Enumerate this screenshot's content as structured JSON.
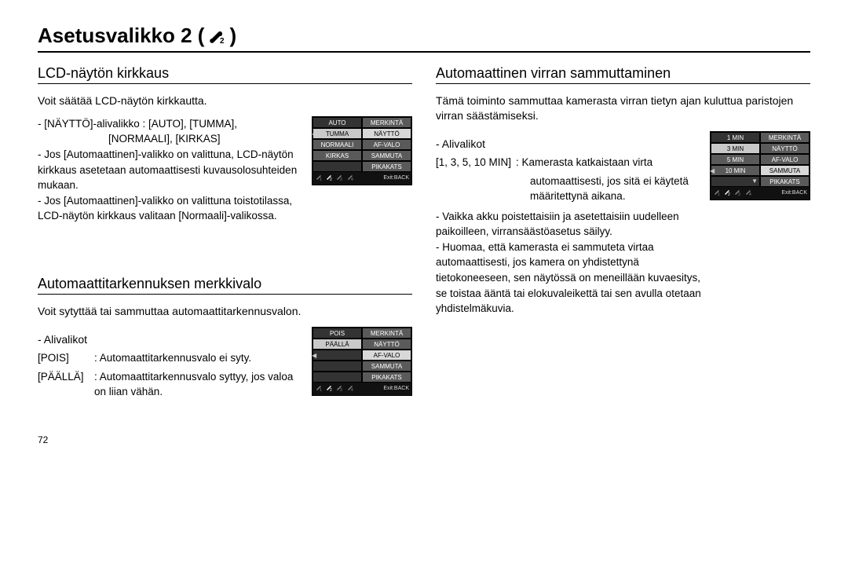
{
  "page_number": "72",
  "title": "Asetusvalikko 2 (",
  "title_close": ")",
  "left": {
    "section1": {
      "heading": "LCD-näytön kirkkaus",
      "intro": "Voit säätää LCD-näytön kirkkautta.",
      "b1a": "- [NÄYTTÖ]-alivalikko : [AUTO], [TUMMA],",
      "b1b": "[NORMAALI], [KIRKAS]",
      "b2": "- Jos [Automaattinen]-valikko on valittuna, LCD-näytön kirkkaus asetetaan automaattisesti kuvausolosuhteiden mukaan.",
      "b3": "- Jos [Automaattinen]-valikko on valittuna toistotilassa, LCD-näytön kirkkaus valitaan [Normaali]-valikossa."
    },
    "menu1": {
      "leftcol": [
        "AUTO",
        "TUMMA",
        "NORMAALI",
        "KIRKAS",
        ""
      ],
      "rightcol": [
        "MERKINTÄ",
        "NÄYTTÖ",
        "AF-VALO",
        "SAMMUTA",
        "PIKAKATS"
      ],
      "exit": "Exit:BACK"
    },
    "section2": {
      "heading": "Automaattitarkennuksen merkkivalo",
      "intro": "Voit sytyttää tai sammuttaa automaattitarkennusvalon.",
      "sublabel": "- Alivalikot",
      "r1k": "[POIS]",
      "r1v": ": Automaattitarkennusvalo ei syty.",
      "r2k": "[PÄÄLLÄ]",
      "r2v": ": Automaattitarkennusvalo syttyy, jos valoa on liian vähän."
    },
    "menu2": {
      "leftcol": [
        "POIS",
        "PÄÄLLÄ",
        "",
        "",
        ""
      ],
      "rightcol": [
        "MERKINTÄ",
        "NÄYTTÖ",
        "AF-VALO",
        "SAMMUTA",
        "PIKAKATS"
      ],
      "exit": "Exit:BACK"
    }
  },
  "right": {
    "section1": {
      "heading": "Automaattinen virran sammuttaminen",
      "intro": "Tämä toiminto sammuttaa kamerasta virran tietyn ajan kuluttua paristojen virran säästämiseksi.",
      "sublabel": "- Alivalikot",
      "r1k": "[1, 3, 5, 10 MIN]",
      "r1v1": ": Kamerasta katkaistaan virta",
      "r1v2": "automaattisesti, jos sitä ei käytetä",
      "r1v3": "määritettynä aikana.",
      "b2": "- Vaikka akku poistettaisiin ja asetettaisiin uudelleen paikoilleen, virransäästöasetus säilyy.",
      "b3": "- Huomaa, että kamerasta ei sammuteta virtaa automaattisesti, jos kamera on yhdistettynä tietokoneeseen, sen näytössä on meneillään kuvaesitys, se toistaa ääntä tai elokuvaleikettä tai sen avulla otetaan yhdistelmäkuvia."
    },
    "menu1": {
      "leftcol": [
        "1 MIN",
        "3 MIN",
        "5 MIN",
        "10 MIN",
        ""
      ],
      "rightcol": [
        "MERKINTÄ",
        "NÄYTTÖ",
        "AF-VALO",
        "SAMMUTA",
        "PIKAKATS"
      ],
      "exit": "Exit:BACK"
    }
  }
}
